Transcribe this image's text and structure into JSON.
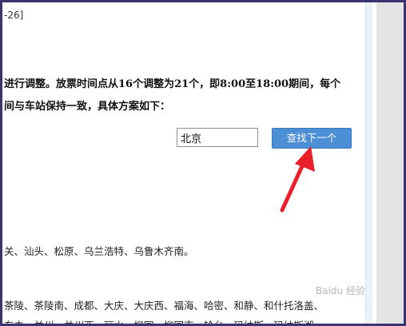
{
  "document": {
    "reference": "-26]",
    "paragraph_line1": "进行调整。放票时间点从16个调整为21个，即8:00至18:00期间，每个",
    "paragraph_line2": "间与车站保持一致，具体方案如下：",
    "station_list_1": "关、汕头、松原、乌兰浩特、乌鲁木齐南。",
    "station_list_2": "茶陵、茶陵南、成都、大庆、大庆西、福海、哈密、和静、和什托洛盖、",
    "station_list_3": "东去、兰州、兰州西、丽水、柳园、柳园南、轮台、玛纳斯、玛纳斯湖"
  },
  "find_bar": {
    "input_value": "北京",
    "button_label": "查找下一个"
  },
  "watermark": {
    "text": "Baidu 经验"
  },
  "colors": {
    "frame": "#3b3470",
    "button": "#4c8fd4",
    "arrow": "#e8202a"
  }
}
